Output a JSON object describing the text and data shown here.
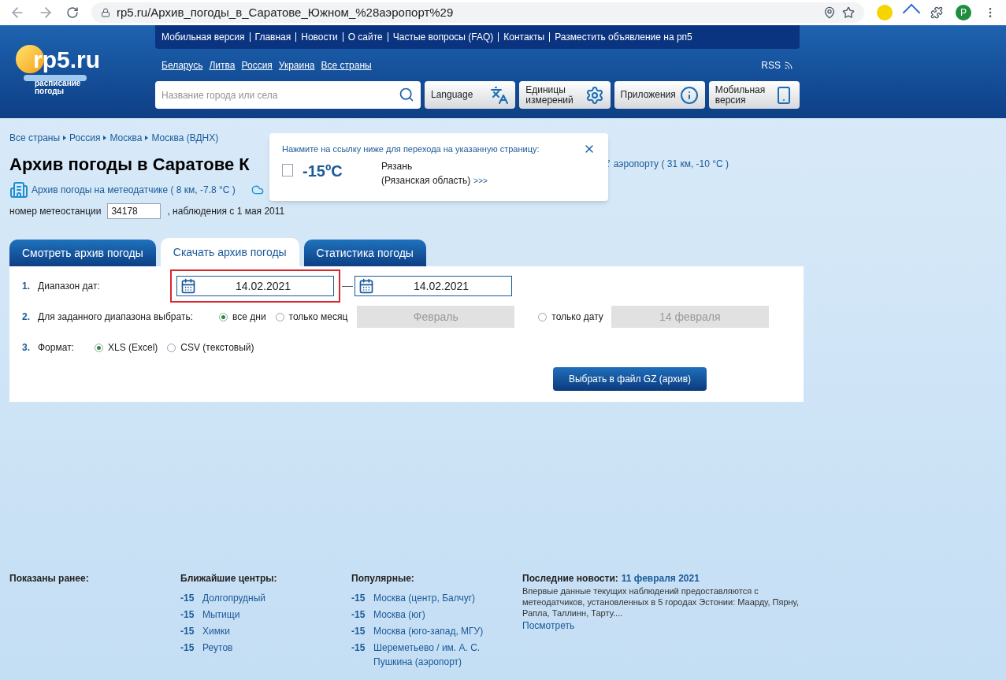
{
  "browser": {
    "url": "rp5.ru/Архив_погоды_в_Саратове_Южном_%28аэропорт%29",
    "avatar": "P"
  },
  "header": {
    "logo": {
      "text": "rp5.ru",
      "subtitle": "расписание погоды"
    },
    "nav_links": [
      "Мобильная версия",
      "Главная",
      "Новости",
      "О сайте",
      "Частые вопросы (FAQ)",
      "Контакты",
      "Разместить объявление на рп5"
    ],
    "countries": [
      "Беларусь",
      "Литва",
      "Россия",
      "Украина",
      "Все страны"
    ],
    "rss": "RSS",
    "search": {
      "placeholder": "Название города или села"
    },
    "buttons": [
      {
        "label": "Language",
        "kind": "language"
      },
      {
        "label": "Единицы измерений",
        "kind": "units"
      },
      {
        "label": "Приложения",
        "kind": "apps"
      },
      {
        "label": "Мобильная версия",
        "kind": "mobile"
      }
    ]
  },
  "breadcrumbs": [
    "Все страны",
    "Россия",
    "Москва",
    "Москва (ВДНХ)"
  ],
  "title": "Архив погоды в Саратове К",
  "airport_link": "аэропорту ( 31 км, -10 °C )",
  "sensor_link": "Архив погоды на метеодатчике ( 8 км, -7.8 °C )",
  "station": {
    "label": "номер метеостанции",
    "value": "34178",
    "since": ", наблюдения с 1 мая 2011"
  },
  "popup": {
    "message": "Нажмите на ссылку ниже для перехода на указанную страницу:",
    "temp": "-15ºC",
    "city": "Рязань",
    "region": "(Рязанская область)",
    "more": ">>>"
  },
  "tabs": [
    {
      "label": "Смотреть архив погоды",
      "selected": false
    },
    {
      "label": "Скачать архив погоды",
      "selected": true
    },
    {
      "label": "Статистика погоды",
      "selected": false
    }
  ],
  "form": {
    "range": {
      "num": "1.",
      "label": "Диапазон дат:",
      "from": "14.02.2021",
      "to": "14.02.2021",
      "highlighted": true
    },
    "choose": {
      "num": "2.",
      "label": "Для заданного диапазона выбрать:",
      "options": [
        {
          "label": "все дни",
          "selected": true
        },
        {
          "label": "только месяц",
          "selected": false,
          "field": "Февраль"
        },
        {
          "label": "только дату",
          "selected": false,
          "field": "14 февраля"
        }
      ]
    },
    "format": {
      "num": "3.",
      "label": "Формат:",
      "options": [
        {
          "label": "XLS (Excel)",
          "selected": true
        },
        {
          "label": "CSV (текстовый)",
          "selected": false
        }
      ]
    },
    "submit": "Выбрать в файл GZ (архив)"
  },
  "footer": {
    "recent": {
      "title": "Показаны ранее:"
    },
    "nearest": {
      "title": "Ближайшие центры:",
      "items": [
        {
          "temp": "-15",
          "name": "Долгопрудный"
        },
        {
          "temp": "-15",
          "name": "Мытищи"
        },
        {
          "temp": "-15",
          "name": "Химки"
        },
        {
          "temp": "-15",
          "name": "Реутов"
        }
      ]
    },
    "popular": {
      "title": "Популярные:",
      "items": [
        {
          "temp": "-15",
          "name": "Москва (центр, Балчуг)"
        },
        {
          "temp": "-15",
          "name": "Москва (юг)"
        },
        {
          "temp": "-15",
          "name": "Москва (юго-запад, МГУ)"
        },
        {
          "temp": "-15",
          "name": "Шереметьево / им. А. С. Пушкина (аэропорт)"
        }
      ]
    },
    "news": {
      "title": "Последние новости:",
      "date": "11 февраля 2021",
      "text": "Впервые данные текущих наблюдений предоставляются с метеодатчиков, установленных в 5 городах Эстонии: Маарду, Пярну, Рапла, Таллинн, Тарту....",
      "more": "Посмотреть"
    }
  }
}
